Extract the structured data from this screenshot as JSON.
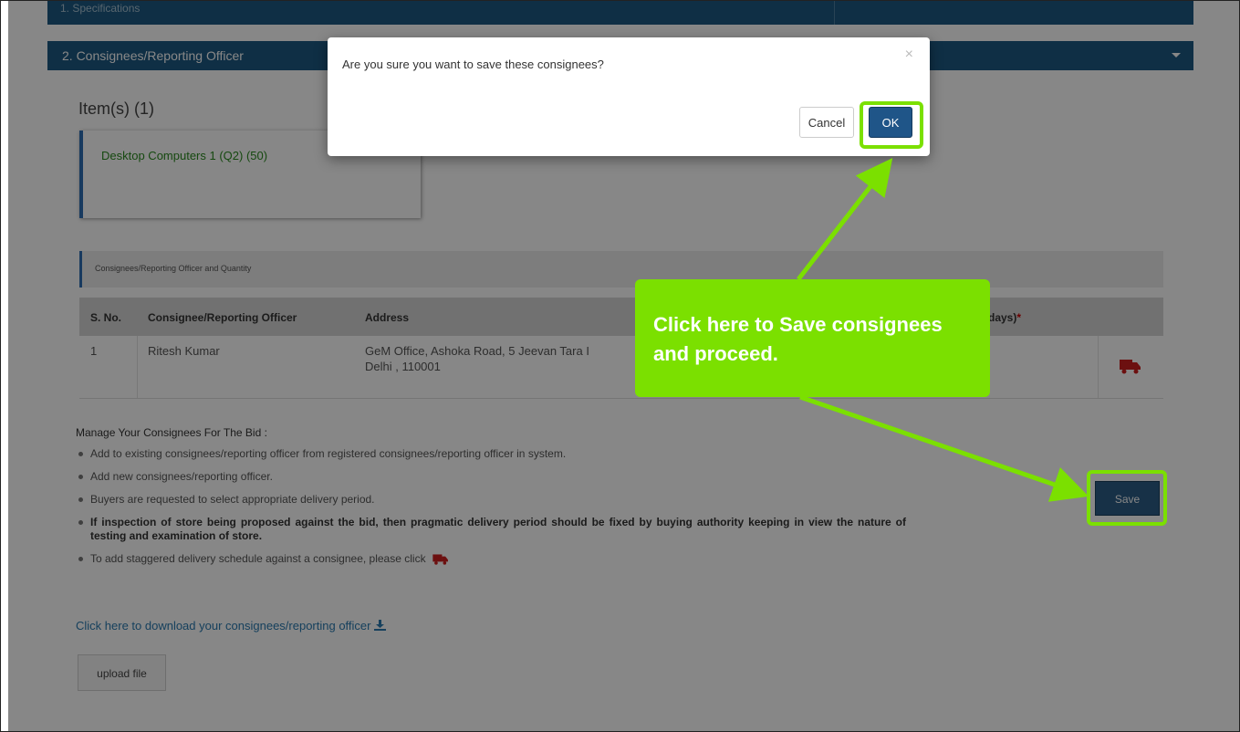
{
  "section_prev": {
    "label": "1. Specifications"
  },
  "section": {
    "title": "2. Consignees/Reporting Officer"
  },
  "items": {
    "title": "Item(s) (1)",
    "card": "Desktop Computers 1  (Q2)  (50)"
  },
  "consignee_section": {
    "label": "Consignees/Reporting Officer and Quantity"
  },
  "table": {
    "headers": [
      "S. No.",
      "Consignee/Reporting Officer",
      "Address",
      "5 days)"
    ],
    "required_mark": "*",
    "rows": [
      {
        "sno": "1",
        "name": "Ritesh Kumar",
        "address_line1": "GeM Office, Ashoka Road, 5 Jeevan Tara I",
        "address_line2": "Delhi , 110001"
      }
    ]
  },
  "manage": {
    "title": "Manage Your Consignees For The Bid :",
    "bullets": [
      "Add to existing consignees/reporting officer from registered consignees/reporting officer in system.",
      "Add new consignees/reporting officer.",
      "Buyers are requested to select appropriate delivery period.",
      "If inspection of store being proposed against the bid, then pragmatic delivery period should be fixed by buying authority keeping in view the nature of testing and examination of store.",
      "To add staggered delivery schedule against a consignee, please click"
    ]
  },
  "download_link": "Click here to download your consignees/reporting officer",
  "upload_button": "upload file",
  "save_button": "Save",
  "modal": {
    "message": "Are you sure you want to save these consignees?",
    "close": "×",
    "cancel": "Cancel",
    "ok": "OK"
  },
  "callout": {
    "text": "Click here to Save consignees and proceed."
  },
  "icons": {
    "truck": "truck-icon",
    "download": "download-icon",
    "close": "close-icon",
    "caret": "caret-down-icon"
  },
  "colors": {
    "header": "#1d5a82",
    "highlight": "#7be000",
    "truck": "#cc1f1f",
    "ok": "#1f5588"
  }
}
